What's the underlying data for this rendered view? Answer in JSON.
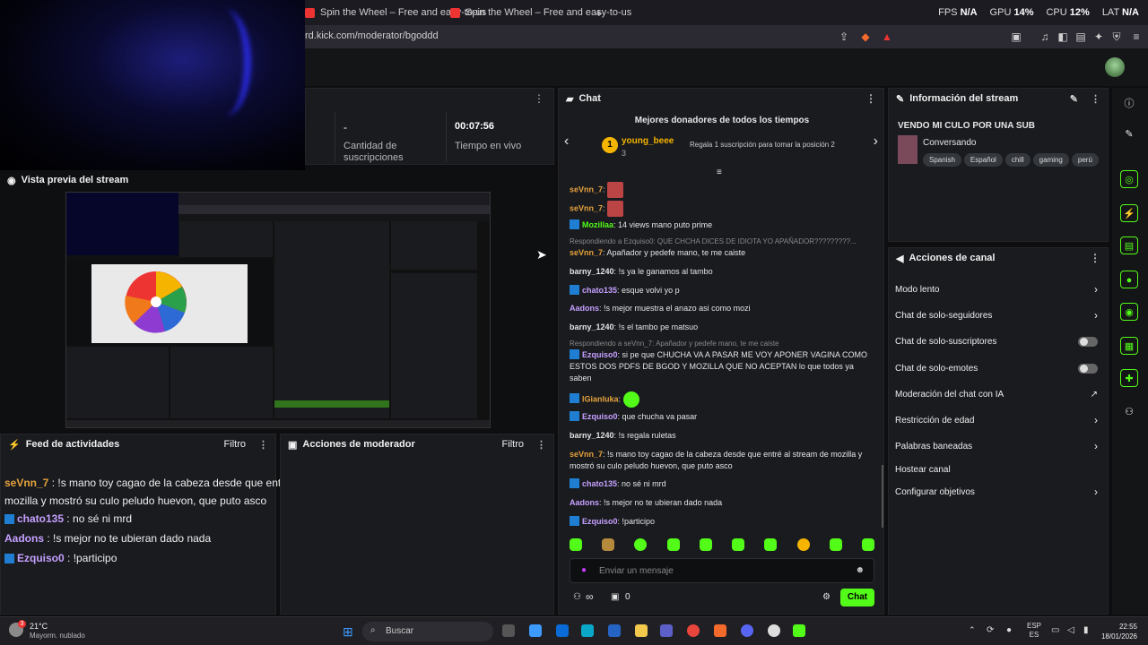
{
  "browser": {
    "tabs": [
      {
        "title": "Spin the Wheel – Free and easy-to-us"
      },
      {
        "title": "Spin the Wheel – Free and easy-to-us"
      }
    ],
    "new_tab": "+",
    "url": "rd.kick.com/moderator/bgoddd",
    "perf": {
      "fps_label": "FPS",
      "fps": "N/A",
      "gpu_label": "GPU",
      "gpu": "14%",
      "cpu_label": "CPU",
      "cpu": "12%",
      "lat_label": "LAT",
      "lat": "N/A"
    }
  },
  "stats": {
    "sub_count": "-",
    "sub_label": "Cantidad de suscripciones",
    "time": "00:07:56",
    "time_label": "Tiempo en vivo"
  },
  "preview": {
    "title": "Vista previa del stream"
  },
  "activity": {
    "title": "Feed de actividades",
    "filter": "Filtro",
    "items": [
      {
        "user": "seVnn_7",
        "text": " : !s mano toy cagao de la cabeza desde que entré al stream de mozilla y mostró su culo peludo huevon, que puto asco",
        "color": "#e6a23c"
      },
      {
        "user": "chato135",
        "text": " : no sé ni mrd",
        "color": "#c6a0ff"
      },
      {
        "user": "Aadons",
        "text": " : !s mejor no te ubieran dado nada",
        "color": "#c6a0ff"
      },
      {
        "user": "Ezquiso0",
        "text": " : !participo",
        "color": "#c6a0ff"
      }
    ]
  },
  "modactions": {
    "title": "Acciones de moderador",
    "filter": "Filtro"
  },
  "chat": {
    "title": "Chat",
    "donors_title": "Mejores donadores de todos los tiempos",
    "donor_rank": "1",
    "donor_name": "young_beee",
    "donor_count": "3",
    "donor_cta": "Regala 1 suscripción para tomar la posición 2",
    "messages": [
      {
        "user": "seVnn_7",
        "text": "",
        "color": "#e6a23c"
      },
      {
        "user": "seVnn_7",
        "text": "",
        "color": "#e6a23c"
      },
      {
        "user": "Mozillaa",
        "text": " 14 views mano puto prime",
        "color": "#53fc18"
      },
      {
        "reply": "Respondiendo a Ezquiso0: QUE CHCHA DICES DE IDIOTA YO APAÑADOR?????????..."
      },
      {
        "user": "seVnn_7",
        "text": " Apañador y pedefe mano, te me caiste",
        "color": "#e6a23c"
      },
      {
        "user": "barny_1240",
        "text": " !s ya le ganamos al tambo",
        "color": "#e0e0e0"
      },
      {
        "user": "chato135",
        "text": " esque volvi yo p",
        "color": "#c6a0ff"
      },
      {
        "user": "Aadons",
        "text": " !s mejor muestra el anazo asi como mozi",
        "color": "#c6a0ff"
      },
      {
        "user": "barny_1240",
        "text": " !s el tambo pe matsuo",
        "color": "#e0e0e0"
      },
      {
        "reply": "Respondiendo a seVnn_7: Apañador y pedefe mano, te me caiste"
      },
      {
        "user": "Ezquiso0",
        "text": " si pe que CHUCHA VA A PASAR ME VOY APONER VAGINA COMO ESTOS DOS PDFS DE BGOD Y MOZILLA QUE NO ACEPTAN lo que todos ya saben",
        "color": "#c6a0ff"
      },
      {
        "user": "lGianluka",
        "text": "",
        "color": "#e6a23c"
      },
      {
        "user": "Ezquiso0",
        "text": " que chucha va pasar",
        "color": "#c6a0ff"
      },
      {
        "user": "barny_1240",
        "text": " !s regala ruletas",
        "color": "#e0e0e0"
      },
      {
        "user": "seVnn_7",
        "text": " !s mano toy cagao de la cabeza desde que entré al stream de mozilla y mostró su culo peludo huevon, que puto asco",
        "color": "#e6a23c"
      },
      {
        "user": "chato135",
        "text": " no sé ni mrd",
        "color": "#c6a0ff"
      },
      {
        "user": "Aadons",
        "text": " !s mejor no te ubieran dado nada",
        "color": "#c6a0ff"
      },
      {
        "user": "Ezquiso0",
        "text": " !participo",
        "color": "#c6a0ff"
      }
    ],
    "input_placeholder": "Enviar un mensaje",
    "infinite": "∞",
    "gift_count": "0",
    "send_label": "Chat"
  },
  "stream_info": {
    "title": "Información del stream",
    "stream_title": "VENDO MI CULO POR UNA SUB",
    "category": "Conversando",
    "tags": [
      "Spanish",
      "Español",
      "chill",
      "gaming",
      "perú"
    ]
  },
  "channel_actions": {
    "title": "Acciones de canal",
    "items": [
      {
        "label": "Modo lento",
        "kind": "chevron"
      },
      {
        "label": "Chat de solo-seguidores",
        "kind": "chevron"
      },
      {
        "label": "Chat de solo-suscriptores",
        "kind": "toggle"
      },
      {
        "label": "Chat de solo-emotes",
        "kind": "toggle"
      },
      {
        "label": "Moderación del chat con IA",
        "kind": "external"
      },
      {
        "label": "Restricción de edad",
        "kind": "chevron"
      },
      {
        "label": "Palabras baneadas",
        "kind": "chevron"
      },
      {
        "label": "Hostear canal",
        "kind": "none"
      },
      {
        "label": "Configurar objetivos",
        "kind": "chevron"
      }
    ]
  },
  "taskbar": {
    "weather_temp": "21°C",
    "weather_desc": "Mayorm. nublado",
    "weather_badge": "3",
    "search": "Buscar",
    "lang": "ESP",
    "lang_sub": "ES",
    "time": "22:55",
    "date": "18/01/2026"
  },
  "colors": {
    "accent": "#53fc18",
    "panel": "#191b1f",
    "bg": "#0e0e10"
  }
}
